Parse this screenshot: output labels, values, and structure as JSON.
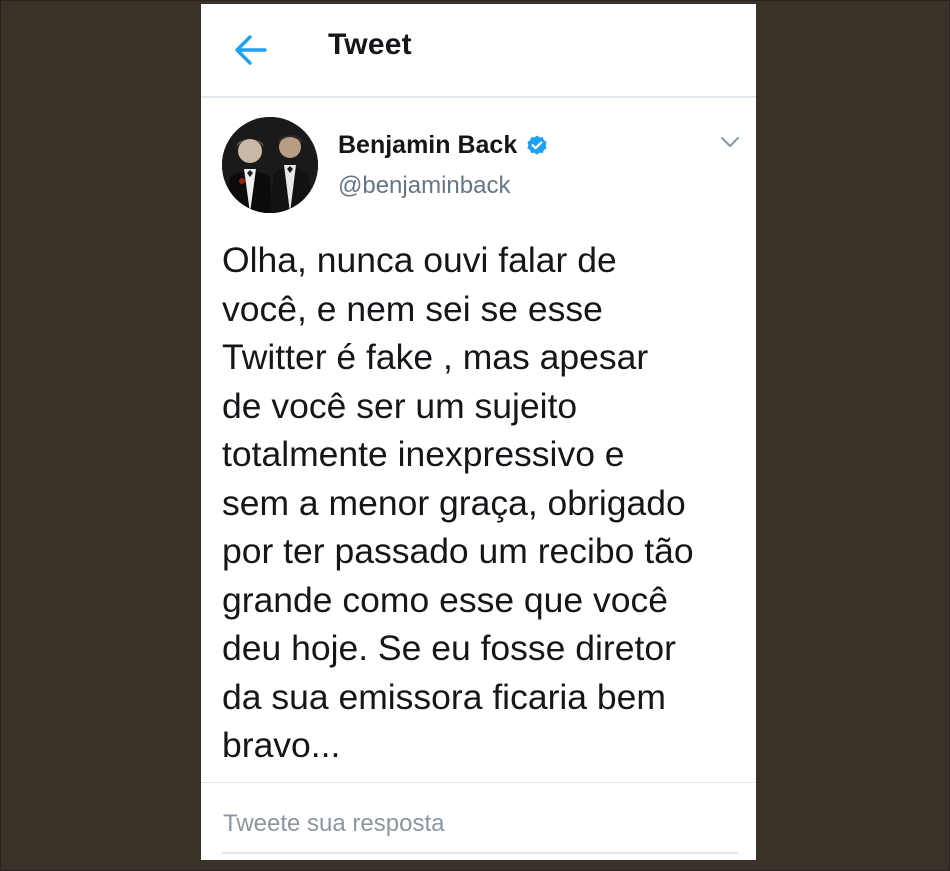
{
  "header": {
    "back_icon": "arrow-left-icon",
    "title": "Tweet"
  },
  "tweet": {
    "author": {
      "display_name": "Benjamin Back",
      "handle": "@benjaminback",
      "verified": true,
      "verified_icon": "verified-badge-icon"
    },
    "menu_icon": "chevron-down-icon",
    "text": "Olha,  nunca ouvi falar de\nvocê, e nem sei se esse\nTwitter é fake , mas apesar\nde você ser um sujeito\ntotalmente inexpressivo e\nsem a menor graça, obrigado\npor ter passado um recibo tão\ngrande como esse que você\ndeu hoje. Se eu fosse diretor\nda sua emissora ficaria bem\nbravo..."
  },
  "reply": {
    "placeholder": "Tweete sua resposta",
    "value": ""
  },
  "colors": {
    "accent": "#1da1f2",
    "text_primary": "#14171a",
    "text_secondary": "#657786",
    "divider": "#e1e8ed",
    "background": "#3a3129"
  }
}
